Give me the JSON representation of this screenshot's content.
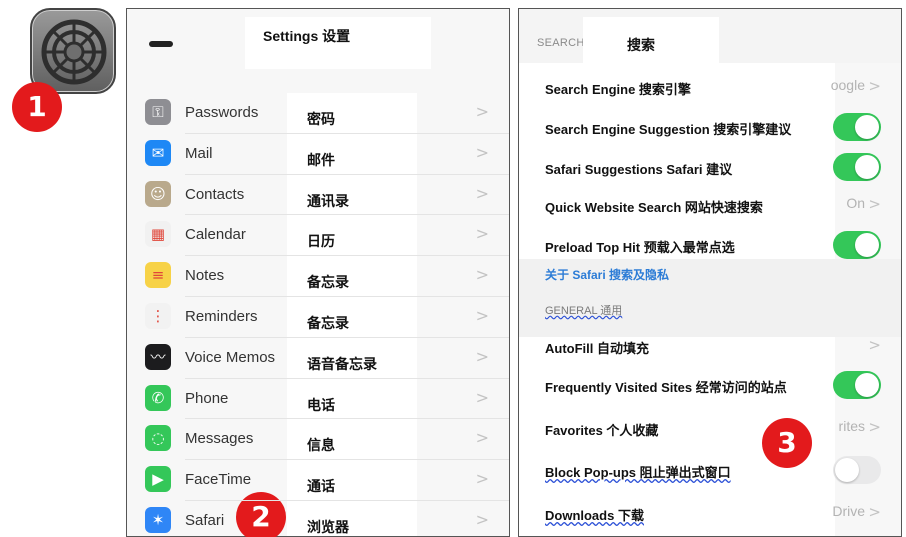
{
  "settings_app_icon": "gear-icon",
  "badges": [
    "1",
    "2",
    "3"
  ],
  "left_panel": {
    "title": "Settings 设置",
    "items": [
      {
        "en": "Passwords",
        "zh": "密码",
        "icon": "key-icon",
        "color": "#8e8e93",
        "glyph": "⚿"
      },
      {
        "en": "Mail",
        "zh": "邮件",
        "icon": "mail-icon",
        "color": "#1e88f5",
        "glyph": "✉"
      },
      {
        "en": "Contacts",
        "zh": "通讯录",
        "icon": "contacts-icon",
        "color": "#b9a98c",
        "glyph": "☺"
      },
      {
        "en": "Calendar",
        "zh": "日历",
        "icon": "calendar-icon",
        "color": "#f1f1f1",
        "glyph": "▦"
      },
      {
        "en": "Notes",
        "zh": "备忘录",
        "icon": "notes-icon",
        "color": "#f7d247",
        "glyph": "≡"
      },
      {
        "en": "Reminders",
        "zh": "备忘录",
        "icon": "reminders-icon",
        "color": "#f2f2f2",
        "glyph": "⋮"
      },
      {
        "en": "Voice Memos",
        "zh": "语音备忘录",
        "icon": "voice-memos-icon",
        "color": "#1c1c1e",
        "glyph": "〰"
      },
      {
        "en": "Phone",
        "zh": "电话",
        "icon": "phone-icon",
        "color": "#34c759",
        "glyph": "✆"
      },
      {
        "en": "Messages",
        "zh": "信息",
        "icon": "messages-icon",
        "color": "#34c759",
        "glyph": "◌"
      },
      {
        "en": "FaceTime",
        "zh": "通话",
        "icon": "facetime-icon",
        "color": "#34c759",
        "glyph": "▶"
      },
      {
        "en": "Safari",
        "zh": "浏览器",
        "icon": "safari-icon",
        "color": "#2f86f6",
        "glyph": "✶"
      }
    ],
    "chevron": ">"
  },
  "right_panel": {
    "tab_search": "SEARCH",
    "tab_title": "搜索",
    "rows": [
      {
        "label": "Search Engine 搜索引擎",
        "value": "oogle",
        "type": "value"
      },
      {
        "label": "Search Engine Suggestion 搜索引擎建议",
        "type": "toggle",
        "on": true
      },
      {
        "label": "Safari Suggestions Safari 建议",
        "type": "toggle",
        "on": true
      },
      {
        "label": "Quick Website Search 网站快速搜索",
        "value": "On",
        "type": "value"
      },
      {
        "label": "Preload Top Hit 预载入最常点选",
        "type": "toggle",
        "on": true
      },
      {
        "label": "AutoFill 自动填充",
        "type": "chevron"
      },
      {
        "label": "Frequently Visited Sites 经常访问的站点",
        "type": "toggle",
        "on": true
      },
      {
        "label": "Favorites 个人收藏",
        "value": "rites",
        "type": "value"
      },
      {
        "label": "Block Pop-ups 阻止弹出式窗口",
        "type": "toggle",
        "on": false
      },
      {
        "label": "Downloads 下载",
        "value": "Drive",
        "type": "value"
      }
    ],
    "link": "关于 Safari 搜索及隐私",
    "section_general": "GENERAL 通用",
    "chevron": ">"
  },
  "colors": {
    "toggle_on": "#34c759",
    "badge": "#e31a1c",
    "link": "#2c7cd6"
  }
}
